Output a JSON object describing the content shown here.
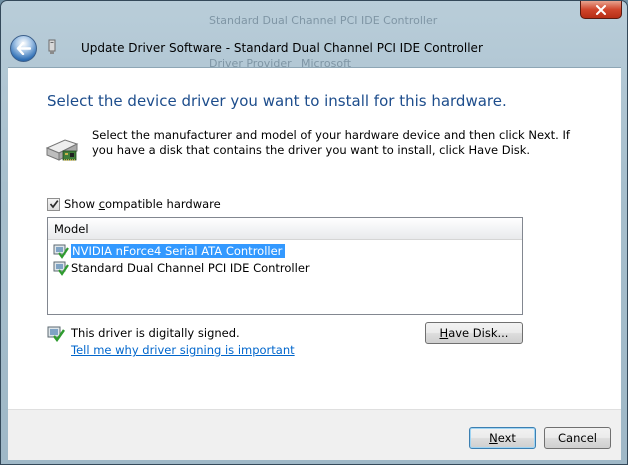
{
  "window": {
    "title": "Update Driver Software - Standard Dual Channel PCI IDE Controller",
    "background_text_1": "Standard Dual Channel PCI IDE Controller",
    "background_text_2": "Driver Provider",
    "background_text_3": "Microsoft"
  },
  "main": {
    "heading": "Select the device driver you want to install for this hardware.",
    "instructions": "Select the manufacturer and model of your hardware device and then click Next. If you have a disk that contains the driver you want to install, click Have Disk.",
    "show_compatible": {
      "label_pre": "Show ",
      "label_key": "c",
      "label_post": "ompatible hardware",
      "checked": true
    },
    "model_list": {
      "header": "Model",
      "items": [
        {
          "label": "NVIDIA nForce4 Serial ATA Controller",
          "selected": true,
          "icon": "driver-signed-icon"
        },
        {
          "label": "Standard Dual Channel PCI IDE Controller",
          "selected": false,
          "icon": "driver-signed-icon"
        }
      ]
    },
    "signing": {
      "status": "This driver is digitally signed.",
      "link": "Tell me why driver signing is important"
    },
    "have_disk": {
      "key": "H",
      "rest": "ave Disk..."
    }
  },
  "footer": {
    "next": {
      "key": "N",
      "rest": "ext"
    },
    "cancel": "Cancel"
  },
  "colors": {
    "heading": "#1d4d8c",
    "link": "#0066cc",
    "selection": "#3399ff",
    "close_button": "#c8432b"
  }
}
